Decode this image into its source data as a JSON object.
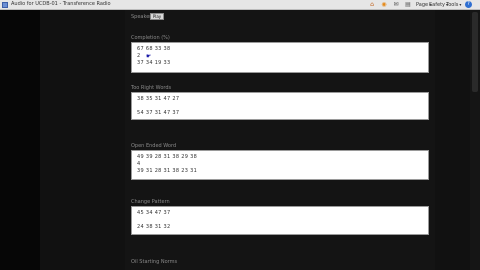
{
  "titlebar": {
    "tab_title": "Audio for UCDB-01 - Transference Radio",
    "page_menu": "Page",
    "safety_menu": "Safety",
    "tools_menu": "Tools",
    "caret": "▾",
    "home_glyph": "⌂",
    "feed_glyph": "◉",
    "mail_glyph": "✉",
    "print_glyph": "▤",
    "help_glyph": "?"
  },
  "speaker": {
    "label": "Speaker:",
    "button": "Play"
  },
  "sections": [
    {
      "label": "Completion (%)",
      "lines": [
        "67 68 33 38",
        "2",
        "37 34 19 33"
      ]
    },
    {
      "label": "Too Right Words",
      "lines": [
        "38 35 31 47 27",
        "",
        "54 37 31 47 37"
      ]
    },
    {
      "label": "Open Ended Word",
      "lines": [
        "49 39 28 31 38 29 38",
        "4",
        "39 31 28 31 38 23 31"
      ]
    },
    {
      "label": "Change Pattern",
      "lines": [
        "45 34 47 37",
        "",
        "24 38 31 32"
      ]
    },
    {
      "label": "Oil Starting Norms",
      "lines": []
    }
  ]
}
